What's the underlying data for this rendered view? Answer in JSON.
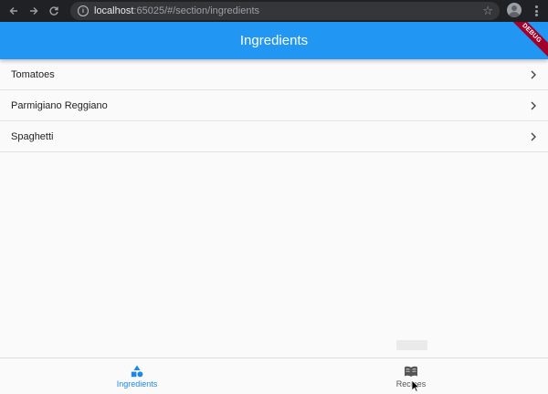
{
  "browser": {
    "url_host": "localhost",
    "url_rest": ":65025/#/section/ingredients",
    "icons": [
      "back-arrow-icon",
      "forward-arrow-icon",
      "reload-icon",
      "info-icon",
      "star-icon",
      "profile-avatar-icon",
      "more-vert-icon"
    ]
  },
  "app_bar": {
    "title": "Ingredients",
    "debug_banner": "DEBUG",
    "color": "#2196f3"
  },
  "list": {
    "items": [
      {
        "label": "Tomatoes",
        "icon": "chevron-right-icon"
      },
      {
        "label": "Parmigiano Reggiano",
        "icon": "chevron-right-icon"
      },
      {
        "label": "Spaghetti",
        "icon": "chevron-right-icon"
      }
    ]
  },
  "bottom_nav": {
    "items": [
      {
        "label": "Ingredients",
        "icon": "category-shapes-icon",
        "selected": true
      },
      {
        "label": "Recipes",
        "icon": "open-book-icon",
        "selected": false
      }
    ],
    "selected_color": "#1e88e5"
  }
}
